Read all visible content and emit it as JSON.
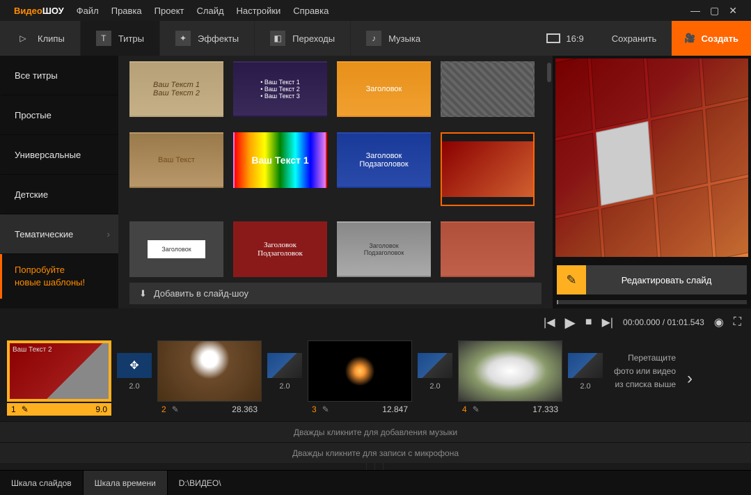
{
  "app": {
    "logo_left": "Видео",
    "logo_right": "ШОУ"
  },
  "menu": [
    "Файл",
    "Правка",
    "Проект",
    "Слайд",
    "Настройки",
    "Справка"
  ],
  "tabs": {
    "clips": "Клипы",
    "titles": "Титры",
    "effects": "Эффекты",
    "transitions": "Переходы",
    "music": "Музыка"
  },
  "top_right": {
    "aspect": "16:9",
    "save": "Сохранить",
    "create": "Создать"
  },
  "sidebar": {
    "items": [
      "Все титры",
      "Простые",
      "Универсальные",
      "Детские",
      "Тематические"
    ],
    "promo_l1": "Попробуйте",
    "promo_l2": "новые шаблоны!"
  },
  "gallery": {
    "add_button": "Добавить в слайд-шоу",
    "thumbs": [
      {
        "label": "Ваш Текст 1\nВаш Текст 2"
      },
      {
        "label": "• Ваш Текст 1\n• Ваш Текст 2\n• Ваш Текст 3"
      },
      {
        "label": "Заголовок"
      },
      {
        "label": ""
      },
      {
        "label": "Ваш Текст"
      },
      {
        "label": "Ваш Текст 1"
      },
      {
        "label": "Заголовок\nПодзаголовок"
      },
      {
        "label": "",
        "selected": true
      },
      {
        "label": "Заголовок"
      },
      {
        "label": "Заголовок\nПодзаголовок"
      },
      {
        "label": "Заголовок\nПодзаголовок"
      },
      {
        "label": ""
      }
    ]
  },
  "preview": {
    "edit_label": "Редактировать слайд"
  },
  "player": {
    "current": "00:00.000",
    "total": "01:01.543"
  },
  "timeline": {
    "slides": [
      {
        "num": "1",
        "dur": "9.0",
        "label": "Ваш Текст 2",
        "selected": true
      },
      {
        "num": "2",
        "dur": "28.363"
      },
      {
        "num": "3",
        "dur": "12.847"
      },
      {
        "num": "4",
        "dur": "17.333"
      }
    ],
    "trans": [
      "2.0",
      "2.0",
      "2.0",
      "2.0"
    ],
    "hint": "Перетащите фото или видео из списка выше",
    "music_hint": "Дважды кликните для добавления музыки",
    "mic_hint": "Дважды кликните для записи с микрофона"
  },
  "bottom": {
    "slides_scale": "Шкала слайдов",
    "time_scale": "Шкала времени",
    "path": "D:\\ВИДЕО\\"
  }
}
